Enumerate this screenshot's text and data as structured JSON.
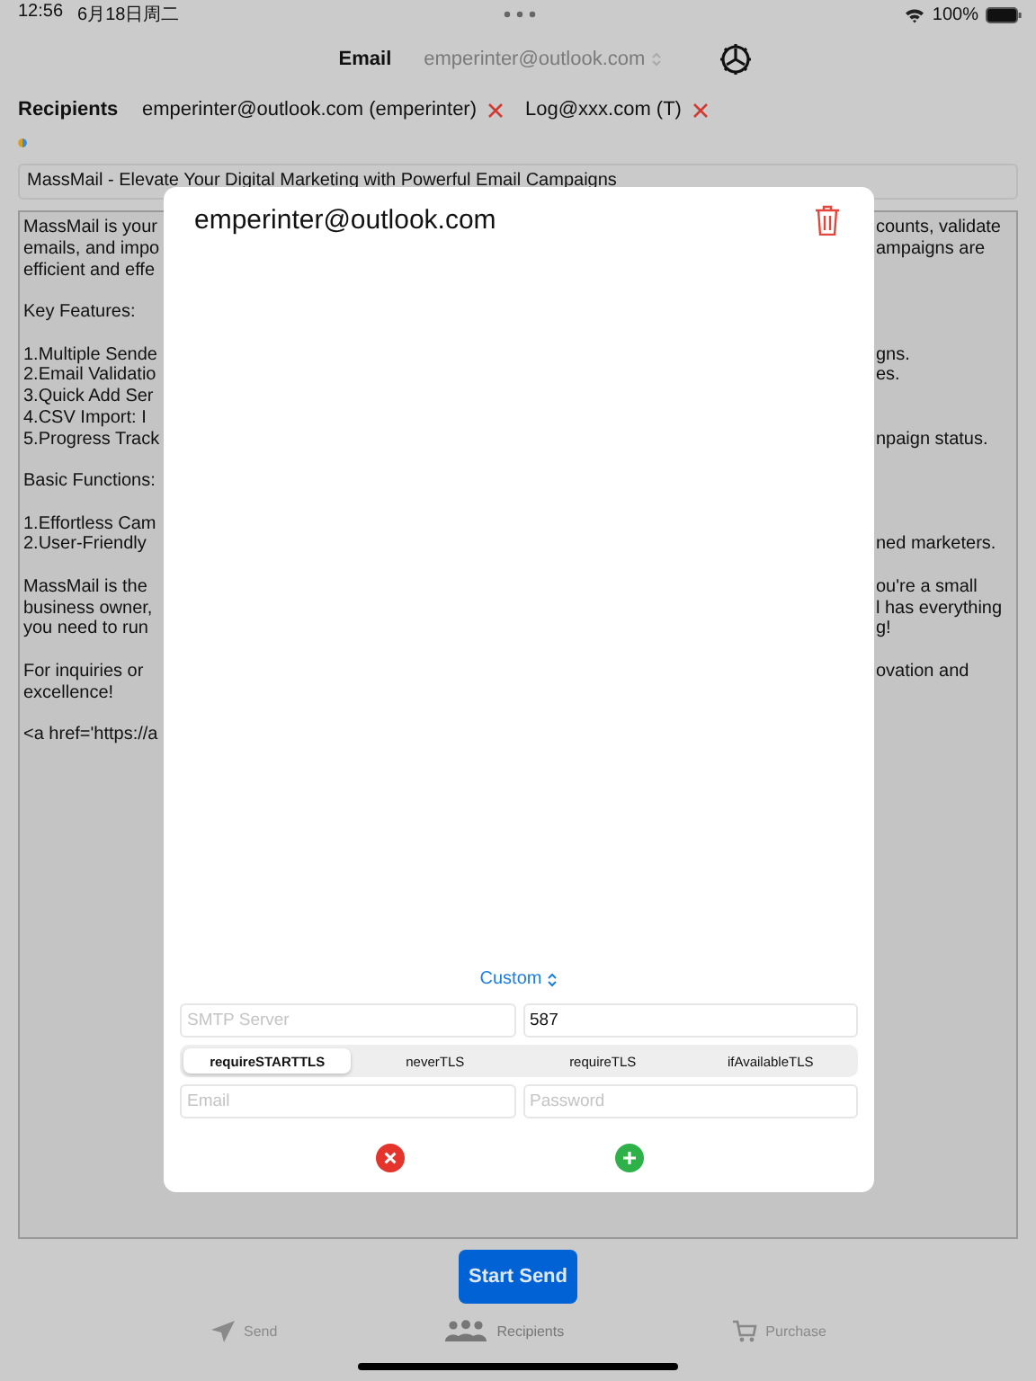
{
  "status_bar": {
    "time": "12:56",
    "date": "6月18日周二",
    "battery": "100%"
  },
  "header": {
    "label": "Email",
    "sender": "emperinter@outlook.com"
  },
  "recipients": {
    "label": "Recipients",
    "items": [
      {
        "text": "emperinter@outlook.com (emperinter)"
      },
      {
        "text": "Log@xxx.com (T)"
      }
    ]
  },
  "subject": "MassMail - Elevate Your Digital Marketing with Powerful Email Campaigns",
  "body_lines": [
    {
      "left": "MassMail is your",
      "right": "counts, validate",
      "space_before": false
    },
    {
      "left": "emails, and impo",
      "right": "ampaigns are",
      "space_before": false
    },
    {
      "left": "efficient and effe",
      "space_before": false
    },
    {
      "left": "Key Features:",
      "space_before": true
    },
    {
      "left": "1.Multiple Sende",
      "right": "gns.",
      "space_before": true
    },
    {
      "left": "2.Email Validatio",
      "right": "es.",
      "space_before": false
    },
    {
      "left": "3.Quick Add Ser",
      "space_before": false
    },
    {
      "left": "4.CSV Import: I",
      "space_before": false
    },
    {
      "left": "5.Progress Track",
      "right": "npaign status.",
      "space_before": false
    },
    {
      "left": "Basic Functions:",
      "space_before": true
    },
    {
      "left": "1.Effortless Cam",
      "space_before": true
    },
    {
      "left": "2.User-Friendly",
      "right": "ned marketers.",
      "space_before": false
    },
    {
      "left": "MassMail is the",
      "right": "ou're a small",
      "space_before": true
    },
    {
      "left": "business owner,",
      "right": "l has everything",
      "space_before": false
    },
    {
      "left": "you need to run",
      "right": "g!",
      "space_before": false
    },
    {
      "left": "For inquiries or",
      "right": "ovation and",
      "space_before": true
    },
    {
      "left": "excellence!",
      "space_before": false
    },
    {
      "left": "<a href='https://a",
      "space_before": true
    }
  ],
  "modal": {
    "title": "emperinter@outlook.com",
    "provider": "Custom",
    "smtp_server": {
      "placeholder": "SMTP Server"
    },
    "port": {
      "value": "587"
    },
    "tls_options": [
      {
        "label": "requireSTARTTLS",
        "selected": true
      },
      {
        "label": "neverTLS",
        "selected": false
      },
      {
        "label": "requireTLS",
        "selected": false
      },
      {
        "label": "ifAvailableTLS",
        "selected": false
      }
    ],
    "email": {
      "placeholder": "Email"
    },
    "password": {
      "placeholder": "Password"
    }
  },
  "start_button": "Start Send",
  "tabs": [
    {
      "label": "Send",
      "selected": false
    },
    {
      "label": "Recipients",
      "selected": true
    },
    {
      "label": "Purchase",
      "selected": false
    }
  ]
}
